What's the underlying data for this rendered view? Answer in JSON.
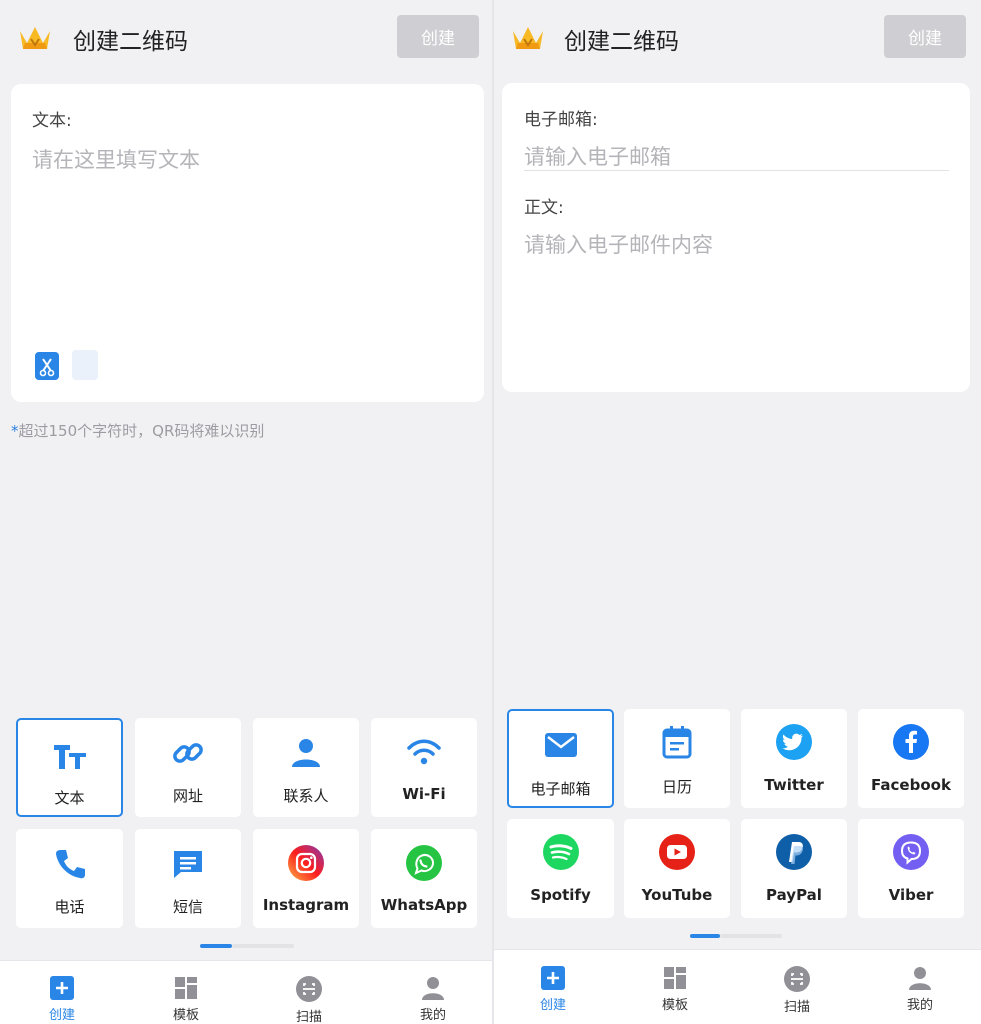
{
  "left": {
    "header": {
      "title": "创建二维码",
      "create_label": "创建"
    },
    "text_label": "文本:",
    "text_placeholder": "请在这里填写文本",
    "note": {
      "star": "*",
      "text": "超过150个字符时，QR码将难以识别"
    },
    "types": [
      {
        "label": "文本",
        "icon": "text-format-icon"
      },
      {
        "label": "网址",
        "icon": "link-icon"
      },
      {
        "label": "联系人",
        "icon": "contact-person-icon"
      },
      {
        "label": "Wi-Fi",
        "icon": "wifi-icon"
      },
      {
        "label": "电话",
        "icon": "phone-icon"
      },
      {
        "label": "短信",
        "icon": "sms-icon"
      },
      {
        "label": "Instagram",
        "icon": "instagram-icon"
      },
      {
        "label": "WhatsApp",
        "icon": "whatsapp-icon"
      }
    ],
    "nav": [
      {
        "label": "创建",
        "icon": "plus-square-icon"
      },
      {
        "label": "模板",
        "icon": "template-grid-icon"
      },
      {
        "label": "扫描",
        "icon": "scan-icon"
      },
      {
        "label": "我的",
        "icon": "profile-icon"
      }
    ]
  },
  "right": {
    "header": {
      "title": "创建二维码",
      "create_label": "创建"
    },
    "email_label": "电子邮箱:",
    "email_placeholder": "请输入电子邮箱",
    "body_label": "正文:",
    "body_placeholder": "请输入电子邮件内容",
    "types": [
      {
        "label": "电子邮箱",
        "icon": "mail-icon"
      },
      {
        "label": "日历",
        "icon": "calendar-icon"
      },
      {
        "label": "Twitter",
        "icon": "twitter-icon"
      },
      {
        "label": "Facebook",
        "icon": "facebook-icon"
      },
      {
        "label": "Spotify",
        "icon": "spotify-icon"
      },
      {
        "label": "YouTube",
        "icon": "youtube-icon"
      },
      {
        "label": "PayPal",
        "icon": "paypal-icon"
      },
      {
        "label": "Viber",
        "icon": "viber-icon"
      }
    ],
    "nav": [
      {
        "label": "创建",
        "icon": "plus-square-icon"
      },
      {
        "label": "模板",
        "icon": "template-grid-icon"
      },
      {
        "label": "扫描",
        "icon": "scan-icon"
      },
      {
        "label": "我的",
        "icon": "profile-icon"
      }
    ]
  },
  "colors": {
    "accent": "#2a86e6",
    "disabled_button": "#cfcfd3",
    "background": "#f1f1f4"
  }
}
